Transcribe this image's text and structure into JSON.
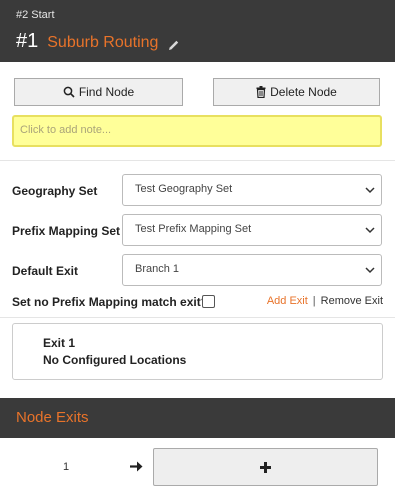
{
  "header": {
    "breadcrumb": "#2 Start",
    "node_number": "#1",
    "node_name": "Suburb Routing"
  },
  "toolbar": {
    "find_label": "Find Node",
    "delete_label": "Delete Node"
  },
  "note": {
    "placeholder": "Click to add note..."
  },
  "form": {
    "geography_label": "Geography Set",
    "geography_value": "Test Geography Set",
    "prefix_label": "Prefix Mapping Set",
    "prefix_value": "Test Prefix Mapping Set",
    "default_exit_label": "Default Exit",
    "default_exit_value": "Branch 1",
    "no_match_label": "Set no Prefix Mapping match exit?",
    "no_match_checked": false
  },
  "exit_actions": {
    "add_label": "Add Exit",
    "separator": "|",
    "remove_label": "Remove Exit"
  },
  "exit_card": {
    "title": "Exit 1",
    "subtitle": "No Configured Locations"
  },
  "node_exits": {
    "title": "Node Exits",
    "rows": [
      {
        "number": "1"
      }
    ]
  },
  "colors": {
    "accent": "#e8732a",
    "header_bg": "#3a3a3a",
    "note_bg": "#ffff99"
  }
}
